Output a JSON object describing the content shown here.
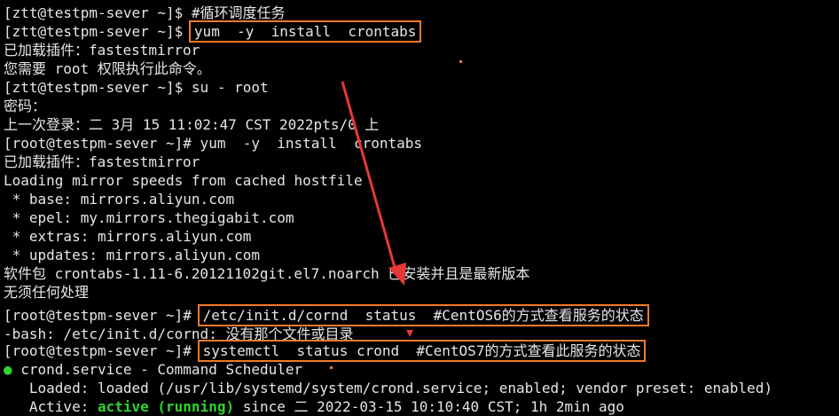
{
  "terminal": {
    "lines": [
      "[ztt@testpm-sever ~]$ #循环调度任务",
      "[ztt@testpm-sever ~]$ ",
      "已加载插件：fastestmirror",
      "您需要 root 权限执行此命令。",
      "[ztt@testpm-sever ~]$ su - root",
      "密码：",
      "上一次登录：二 3月 15 11:02:47 CST 2022pts/0 上",
      "[root@testpm-sever ~]# yum  -y  install  crontabs",
      "已加载插件：fastestmirror",
      "Loading mirror speeds from cached hostfile",
      " * base: mirrors.aliyun.com",
      " * epel: my.mirrors.thegigabit.com",
      " * extras: mirrors.aliyun.com",
      " * updates: mirrors.aliyun.com",
      "软件包 crontabs-1.11-6.20121102git.el7.noarch 已安装并且是最新版本",
      "无须任何处理",
      "[root@testpm-sever ~]# ",
      "-bash: /etc/init.d/cornd: 没有那个文件或目录",
      "[root@testpm-sever ~]# ",
      " crond.service - Command Scheduler",
      "   Loaded: loaded (/usr/lib/systemd/system/crond.service; enabled; vendor preset: enabled)",
      "   Active: ",
      " since 二 2022-03-15 10:10:40 CST; 1h 2min ago"
    ],
    "highlighted_cmd_1": "yum  -y  install  crontabs",
    "highlighted_cmd_2": "/etc/init.d/cornd  status  #CentOS6的方式查看服务的状态",
    "highlighted_cmd_3": "systemctl  status crond  #CentOS7的方式查看此服务的状态",
    "status_bullet": "●",
    "active_state": "active (running)"
  },
  "colors": {
    "background": "#000000",
    "text": "#e6e6e6",
    "highlight_box": "#f07b26",
    "arrow": "#e53935",
    "active_green": "#2fd22f"
  },
  "annotation": {
    "arrow_icon": "red-arrow-icon"
  }
}
